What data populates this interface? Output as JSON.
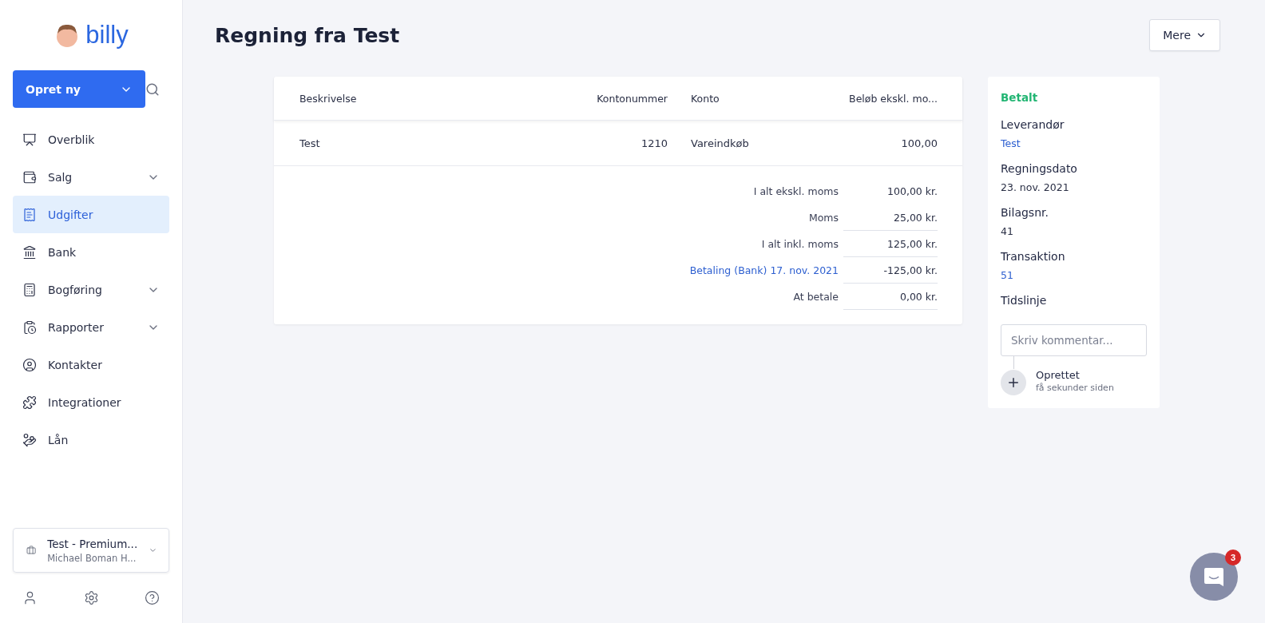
{
  "logo": {
    "text": "billy"
  },
  "create_button": {
    "label": "Opret ny"
  },
  "nav": [
    {
      "label": "Overblik",
      "expandable": false,
      "selected": false
    },
    {
      "label": "Salg",
      "expandable": true,
      "selected": false
    },
    {
      "label": "Udgifter",
      "expandable": false,
      "selected": true
    },
    {
      "label": "Bank",
      "expandable": false,
      "selected": false
    },
    {
      "label": "Bogføring",
      "expandable": true,
      "selected": false
    },
    {
      "label": "Rapporter",
      "expandable": true,
      "selected": false
    },
    {
      "label": "Kontakter",
      "expandable": false,
      "selected": false
    },
    {
      "label": "Integrationer",
      "expandable": false,
      "selected": false
    },
    {
      "label": "Lån",
      "expandable": false,
      "selected": false
    }
  ],
  "account": {
    "name": "Test - Premium...",
    "owner": "Michael Boman H..."
  },
  "page_title": "Regning fra Test",
  "more_button": {
    "label": "Mere"
  },
  "table": {
    "columns": [
      "Beskrivelse",
      "Kontonummer",
      "Konto",
      "Beløb ekskl. mo..."
    ],
    "rows": [
      [
        "Test",
        "1210",
        "Vareindkøb",
        "100,00"
      ]
    ]
  },
  "totals": [
    {
      "label": "I alt ekskl. moms",
      "value": "100,00 kr.",
      "kind": "plain"
    },
    {
      "label": "Moms",
      "value": "25,00 kr.",
      "kind": "plain"
    },
    {
      "label": "I alt inkl. moms",
      "value": "125,00 kr.",
      "kind": "plain"
    },
    {
      "label": "Betaling (Bank) 17. nov. 2021",
      "value": "-125,00 kr.",
      "kind": "link"
    },
    {
      "label": "At betale",
      "value": "0,00 kr.",
      "kind": "plain"
    }
  ],
  "details": {
    "status": "Betalt",
    "fields": [
      {
        "label": "Leverandør",
        "value": "Test",
        "kind": "link"
      },
      {
        "label": "Regningsdato",
        "value": "23. nov. 2021",
        "kind": "plain"
      },
      {
        "label": "Bilagsnr.",
        "value": "41",
        "kind": "plain"
      },
      {
        "label": "Transaktion",
        "value": "51",
        "kind": "link"
      }
    ],
    "timeline_title": "Tidslinje",
    "comment_placeholder": "Skriv kommentar...",
    "events": [
      {
        "title": "Oprettet",
        "time": "få sekunder siden"
      }
    ]
  },
  "chat": {
    "badge": "3"
  }
}
